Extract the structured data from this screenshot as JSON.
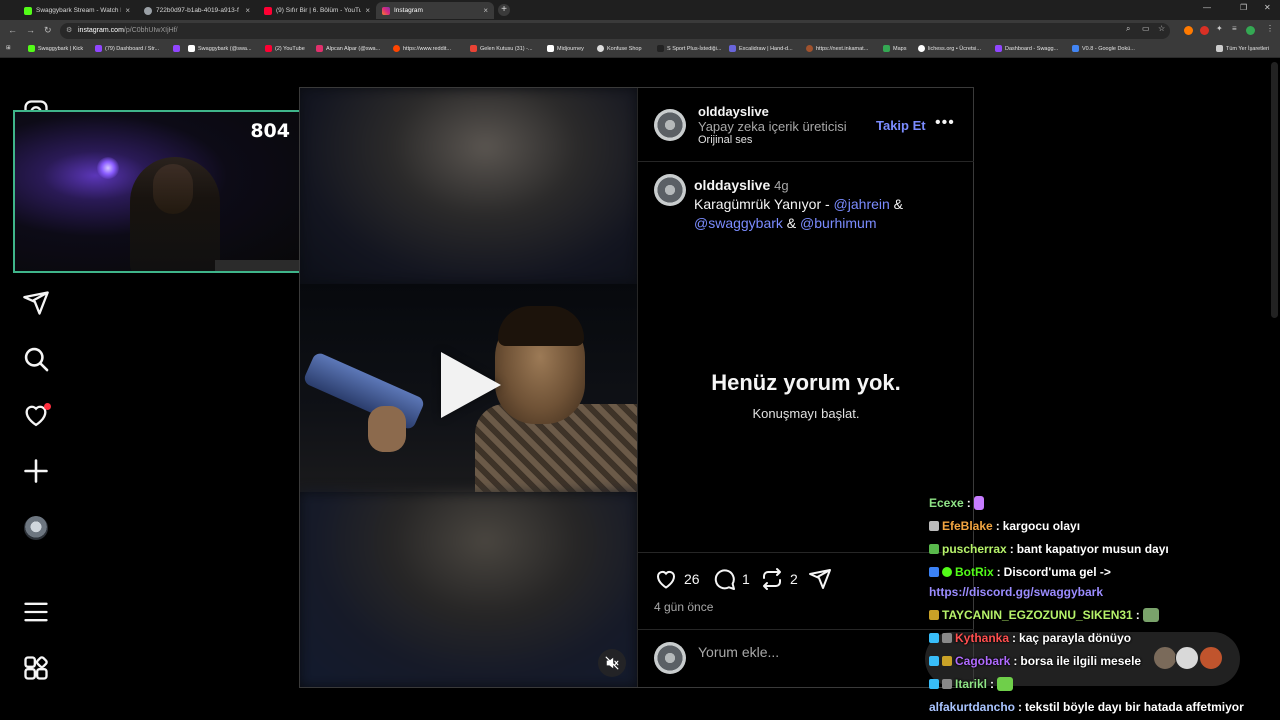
{
  "browser": {
    "tabs": [
      {
        "title": "Swaggybark Stream - Watch Li",
        "color": "#53fc18"
      },
      {
        "title": "722b0d97-b1ab-4019-a913-f",
        "color": "#9aa0a6"
      },
      {
        "title": "(9) Sıfır Bir | 6. Bölüm - YouTube",
        "color": "#ff0033"
      },
      {
        "title": "Instagram",
        "color": "#e1306c"
      }
    ],
    "url_main": "instagram.com",
    "url_rest": "/p/C0bhUIwXIjHf/",
    "bookmarks": [
      {
        "label": "Swaggybark | Kick",
        "color": "#53fc18"
      },
      {
        "label": "(79) Dashboard / Str...",
        "color": "#9146ff"
      },
      {
        "label": "",
        "color": "#9146ff"
      },
      {
        "label": "Swaggybark (@swa...",
        "color": "#ffffff"
      },
      {
        "label": "(2) YouTube",
        "color": "#ff0033"
      },
      {
        "label": "Alpcan Alpar (@swa...",
        "color": "#e1306c"
      },
      {
        "label": "https://www.reddit...",
        "color": "#ff4500"
      },
      {
        "label": "Gelen Kutusu (31) -...",
        "color": "#ea4335"
      },
      {
        "label": "Midjourney",
        "color": "#ffffff"
      },
      {
        "label": "Konfuse Shop",
        "color": "#dddddd"
      },
      {
        "label": "S Sport Plus-İstediği...",
        "color": "#222222"
      },
      {
        "label": "Excalidraw | Hand-d...",
        "color": "#6965db"
      },
      {
        "label": "https://next.inkamat...",
        "color": "#a0522d"
      },
      {
        "label": "Maps",
        "color": "#34a853"
      },
      {
        "label": "lichess.org • Ücretsi...",
        "color": "#ffffff"
      },
      {
        "label": "Dashboard - Swagg...",
        "color": "#9146ff"
      },
      {
        "label": "V0.8 - Google Dokü...",
        "color": "#4285f4"
      },
      {
        "label": "Tüm Yer İşaretleri",
        "color": "#cccccc"
      }
    ]
  },
  "webcam": {
    "count": "804"
  },
  "post": {
    "author": "olddayslive",
    "author_subtitle": "Yapay zeka içerik üreticisi",
    "audio": "Orijinal ses",
    "follow_label": "Takip Et",
    "caption_time": "4g",
    "caption_text": "Karagümrük Yanıyor - ",
    "mention1": "@jahrein",
    "amp": " & ",
    "mention2": "@swaggybark",
    "mention3": "@burhimum",
    "empty_title": "Henüz yorum yok.",
    "empty_subtitle": "Konuşmayı başlat.",
    "likes": "26",
    "comments": "1",
    "reposts": "2",
    "ago": "4 gün önce",
    "comment_placeholder": "Yorum ekle..."
  },
  "chat": [
    {
      "user": "Ecexe",
      "color": "#8fe386",
      "message": "",
      "emote": "#c77dff"
    },
    {
      "user": "EfeBlake",
      "color": "#f2a541",
      "message": "kargocu olayı",
      "badge": "#bbbbbb"
    },
    {
      "user": "puscherrax",
      "color": "#b6f26a",
      "message": "bant kapatıyor musun dayı",
      "badge": "#59b84c"
    },
    {
      "user": "BotRix",
      "color": "#53fc18",
      "message": "Discord'uma gel ->",
      "badge": "#3b82f6"
    },
    {
      "user": "",
      "color": "#9b8cff",
      "message": "https://discord.gg/swaggybark",
      "link": true
    },
    {
      "user": "TAYCANIN_EGZOZUNU_SIKEN31",
      "color": "#b6f26a",
      "message": "",
      "badge": "#c9a227",
      "emote": "#7aa36b"
    },
    {
      "user": "Kythanka",
      "color": "#ff4f4f",
      "message": "kaç parayla dönüyo",
      "badge": "#38bdf8"
    },
    {
      "user": "Cagobark",
      "color": "#b06bff",
      "message": "borsa ile ilgili mesele",
      "badge": "#38bdf8"
    },
    {
      "user": "Itarikl",
      "color": "#8fe386",
      "message": "",
      "badge": "#38bdf8",
      "emote": "#6fcf4a"
    },
    {
      "user": "alfakurtdancho",
      "color": "#a9c4ff",
      "message": "tekstil böyle dayı bir hatada affetmiyor"
    }
  ],
  "colors": {
    "accent_link": "#7b8cff",
    "notification": "#ff3040",
    "webcam_border": "#3fb58a"
  }
}
